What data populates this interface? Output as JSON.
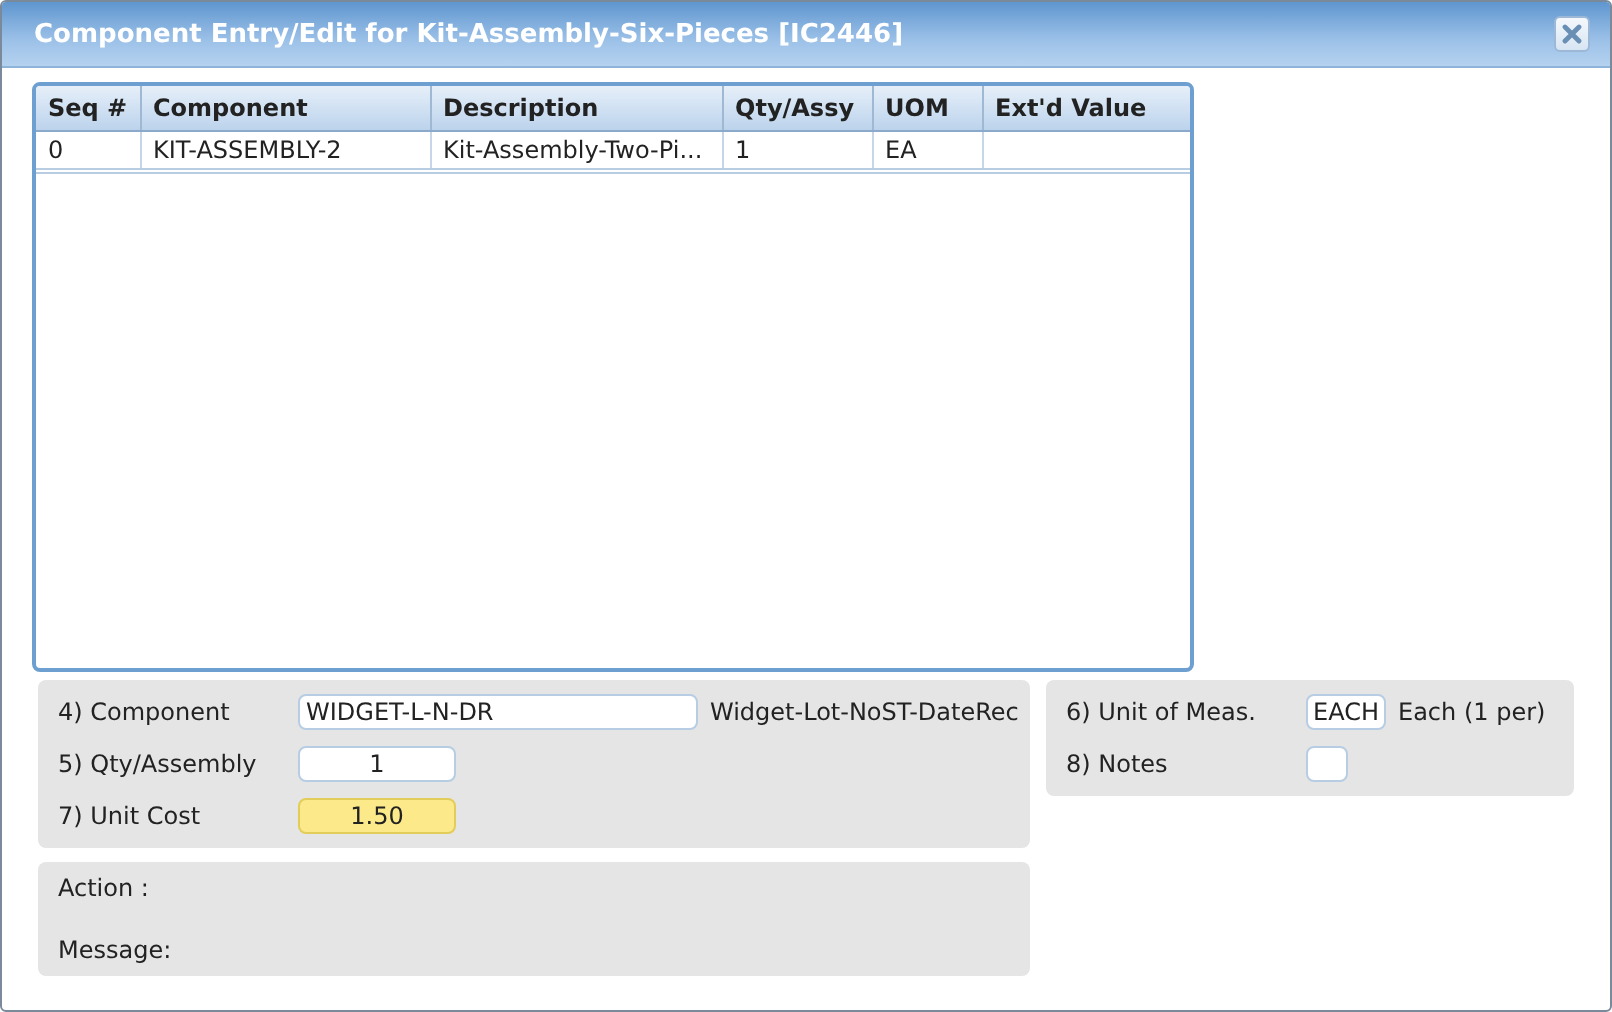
{
  "window": {
    "title": "Component Entry/Edit for Kit-Assembly-Six-Pieces [IC2446]"
  },
  "grid": {
    "columns": [
      "Seq #",
      "Component",
      "Description",
      "Qty/Assy",
      "UOM",
      "Ext'd Value"
    ],
    "rows": [
      {
        "cells": [
          "0",
          "KIT-ASSEMBLY-2",
          "Kit-Assembly-Two-Pi...",
          "1",
          "EA",
          ""
        ]
      }
    ]
  },
  "form": {
    "left_fields": [
      {
        "label": "4) Component",
        "kind": "text",
        "value": "WIDGET-L-N-DR",
        "note": "Widget-Lot-NoST-DateRec"
      },
      {
        "label": "5) Qty/Assembly",
        "kind": "number",
        "value": "1"
      },
      {
        "label": "7) Unit Cost",
        "kind": "highlighted",
        "value": "1.50"
      }
    ],
    "right_fields": [
      {
        "label": "6) Unit of Meas.",
        "kind": "short",
        "value": "EACH",
        "note": "Each (1 per)"
      },
      {
        "label": "8) Notes",
        "kind": "tiny"
      }
    ]
  },
  "status": {
    "action_label": "Action :",
    "message_label": "Message:"
  }
}
